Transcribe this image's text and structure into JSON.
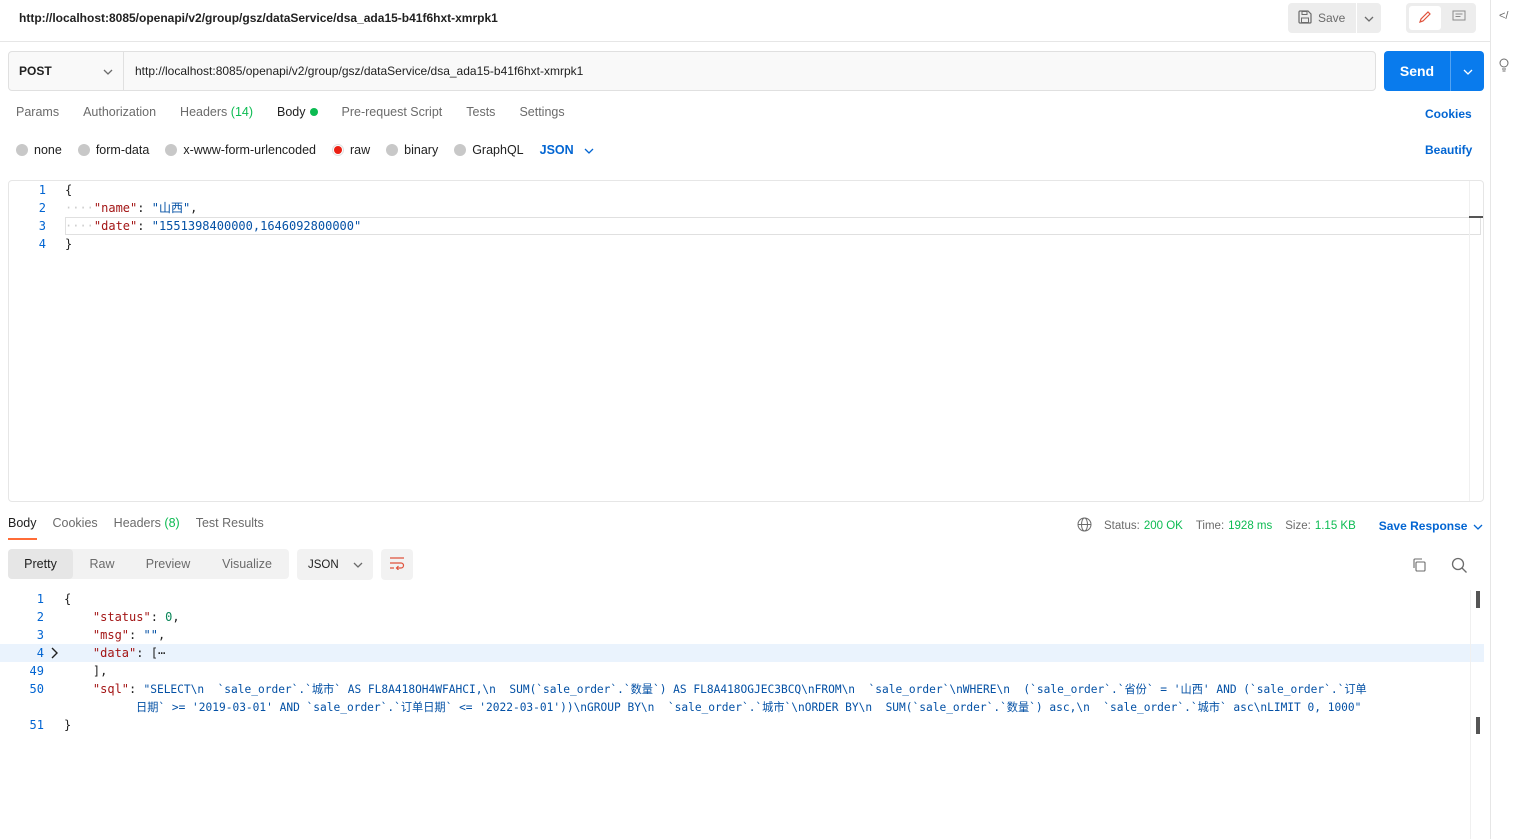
{
  "request": {
    "title": "http://localhost:8085/openapi/v2/group/gsz/dataService/dsa_ada15-b41f6hxt-xmrpk1",
    "save_label": "Save",
    "method": "POST",
    "url": "http://localhost:8085/openapi/v2/group/gsz/dataService/dsa_ada15-b41f6hxt-xmrpk1",
    "send_label": "Send"
  },
  "request_tabs": [
    {
      "label": "Params"
    },
    {
      "label": "Authorization"
    },
    {
      "label": "Headers",
      "count": "(14)"
    },
    {
      "label": "Body"
    },
    {
      "label": "Pre-request Script"
    },
    {
      "label": "Tests"
    },
    {
      "label": "Settings"
    }
  ],
  "cookies_label": "Cookies",
  "body_types": [
    "none",
    "form-data",
    "x-www-form-urlencoded",
    "raw",
    "binary",
    "GraphQL"
  ],
  "body_format": "JSON",
  "beautify_label": "Beautify",
  "request_body": {
    "line_numbers": [
      "1",
      "2",
      "3",
      "4"
    ],
    "brace_open": "{",
    "brace_close": "}",
    "name_key": "\"name\"",
    "name_value": "\"山西\"",
    "date_key": "\"date\"",
    "date_value": "\"1551398400000,1646092800000\""
  },
  "response_tabs": [
    {
      "label": "Body"
    },
    {
      "label": "Cookies"
    },
    {
      "label": "Headers",
      "count": "(8)"
    },
    {
      "label": "Test Results"
    }
  ],
  "response_meta": {
    "status_label": "Status:",
    "status_value": "200 OK",
    "time_label": "Time:",
    "time_value": "1928 ms",
    "size_label": "Size:",
    "size_value": "1.15 KB",
    "save_response_label": "Save Response"
  },
  "view_modes": [
    "Pretty",
    "Raw",
    "Preview",
    "Visualize"
  ],
  "response_format": "JSON",
  "response_body": {
    "line_numbers": [
      "1",
      "2",
      "3",
      "4",
      "49",
      "50",
      "51"
    ],
    "status_key": "\"status\"",
    "status_value": "0",
    "msg_key": "\"msg\"",
    "msg_value": "\"\"",
    "data_key": "\"data\"",
    "data_folded": "[⋯",
    "data_close": "],",
    "sql_key": "\"sql\"",
    "sql_value_line1": "\"SELECT\\n  `sale_order`.`城市` AS FL8A418OH4WFAHCI,\\n  SUM(`sale_order`.`数量`) AS FL8A418OGJEC3BCQ\\nFROM\\n  `sale_order`\\nWHERE\\n  (`sale_order`.`省份` = '山西' AND (`sale_order`.`订单",
    "sql_value_line2": "日期` >= '2019-03-01' AND `sale_order`.`订单日期` <= '2022-03-01'))\\nGROUP BY\\n  `sale_order`.`城市`\\nORDER BY\\n  SUM(`sale_order`.`数量`) asc,\\n  `sale_order`.`城市` asc\\nLIMIT 0, 1000\""
  }
}
